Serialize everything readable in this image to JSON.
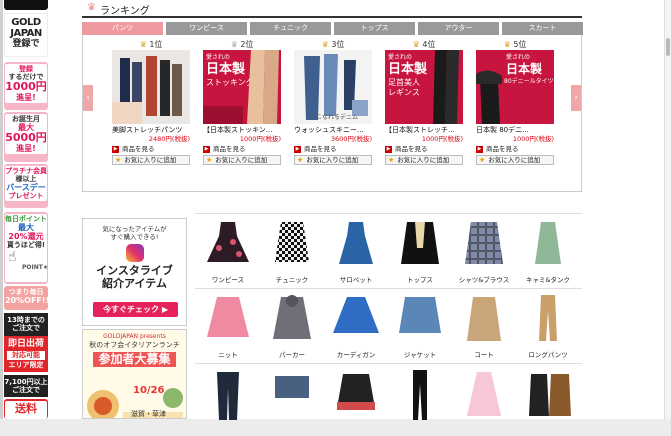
{
  "sidebar": {
    "brand": [
      "GOLD",
      "JAPAN",
      "登録で"
    ],
    "brand_note": "",
    "promo1": {
      "lines": [
        "登録",
        "するだけで",
        "1000円",
        "進呈!"
      ]
    },
    "promo2": {
      "lines": [
        "お誕生月",
        "最大",
        "5000円",
        "進呈!"
      ]
    },
    "promo3": {
      "lines": [
        "プラチナ会員",
        "様以上",
        "バースデー",
        "プレゼント"
      ]
    },
    "promo4": {
      "lines": [
        "毎日ポイント",
        "最大",
        "20%還元",
        "貰うほど得!"
      ]
    },
    "promo4_extra": "POINT★",
    "promo5": {
      "lines": [
        "つまり毎日",
        "20%OFF!!"
      ]
    },
    "black1": {
      "lines": [
        "13時までの",
        "ご注文で"
      ]
    },
    "red1": {
      "lines": [
        "即日出荷",
        "対応可能",
        "エリア限定"
      ]
    },
    "black2": {
      "lines": [
        "7,100円以上",
        "ご注文で"
      ]
    },
    "promo6": {
      "lines": [
        "送料"
      ]
    }
  },
  "ranking": {
    "crown_icon": "crown-icon",
    "title": "ランキング",
    "tabs": [
      "パンツ",
      "ワンピース",
      "チュニック",
      "トップス",
      "アウター",
      "スカート"
    ],
    "active_tab": 0,
    "items": [
      {
        "rank": "1位",
        "name": "美脚ストレッチパンツ",
        "price": "2480円(税抜)",
        "see": "商品を見る",
        "fav": "お気に入りに追加"
      },
      {
        "rank": "2位",
        "name": "【日本製ストッキン...",
        "price": "1000円(税抜)",
        "see": "商品を見る",
        "fav": "お気に入りに追加"
      },
      {
        "rank": "3位",
        "name": "ウォッシュスキニー...",
        "price": "3600円(税抜)",
        "see": "商品を見る",
        "fav": "お気に入りに追加"
      },
      {
        "rank": "4位",
        "name": "【日本製ストレッチ...",
        "price": "1000円(税抜)",
        "see": "商品を見る",
        "fav": "お気に入りに追加"
      },
      {
        "rank": "5位",
        "name": "日本製 80デニ...",
        "price": "1000円(税抜)",
        "see": "商品を見る",
        "fav": "お気に入りに追加"
      }
    ],
    "img_text": {
      "i2": [
        "愛されの",
        "日本製",
        "ストッキング"
      ],
      "i3": [
        "こなれるデニム"
      ],
      "i4": [
        "愛されの",
        "日本製",
        "足首美人",
        "レギンス"
      ],
      "i5": [
        "愛されの",
        "日本製",
        "80デニールタイツ"
      ]
    }
  },
  "insta": {
    "line1": "気になったアイテムが",
    "line2": "すぐ購入できる!",
    "head1": "インスタライブ",
    "head2": "紹介アイテム",
    "button": "今すぐチェック ▶"
  },
  "lunch": {
    "line1": "GOLDJAPAN presents",
    "line2": "秋のオフ会イタリアンランチ",
    "head": "参加者大募集",
    "date": "10/26",
    "place": "滋賀・草津"
  },
  "categories": [
    [
      "ワンピース",
      "チュニック",
      "サロペット",
      "トップス",
      "シャツ&ブラウス",
      "キャミ&タンク"
    ],
    [
      "ニット",
      "パーカー",
      "カーディガン",
      "ジャケット",
      "コート",
      "ロングパンツ"
    ],
    [
      "",
      "",
      "",
      "",
      "",
      ""
    ]
  ],
  "colors": {
    "accent": "#ef9aa0",
    "tab": "#999999",
    "price": "#dd0011"
  }
}
